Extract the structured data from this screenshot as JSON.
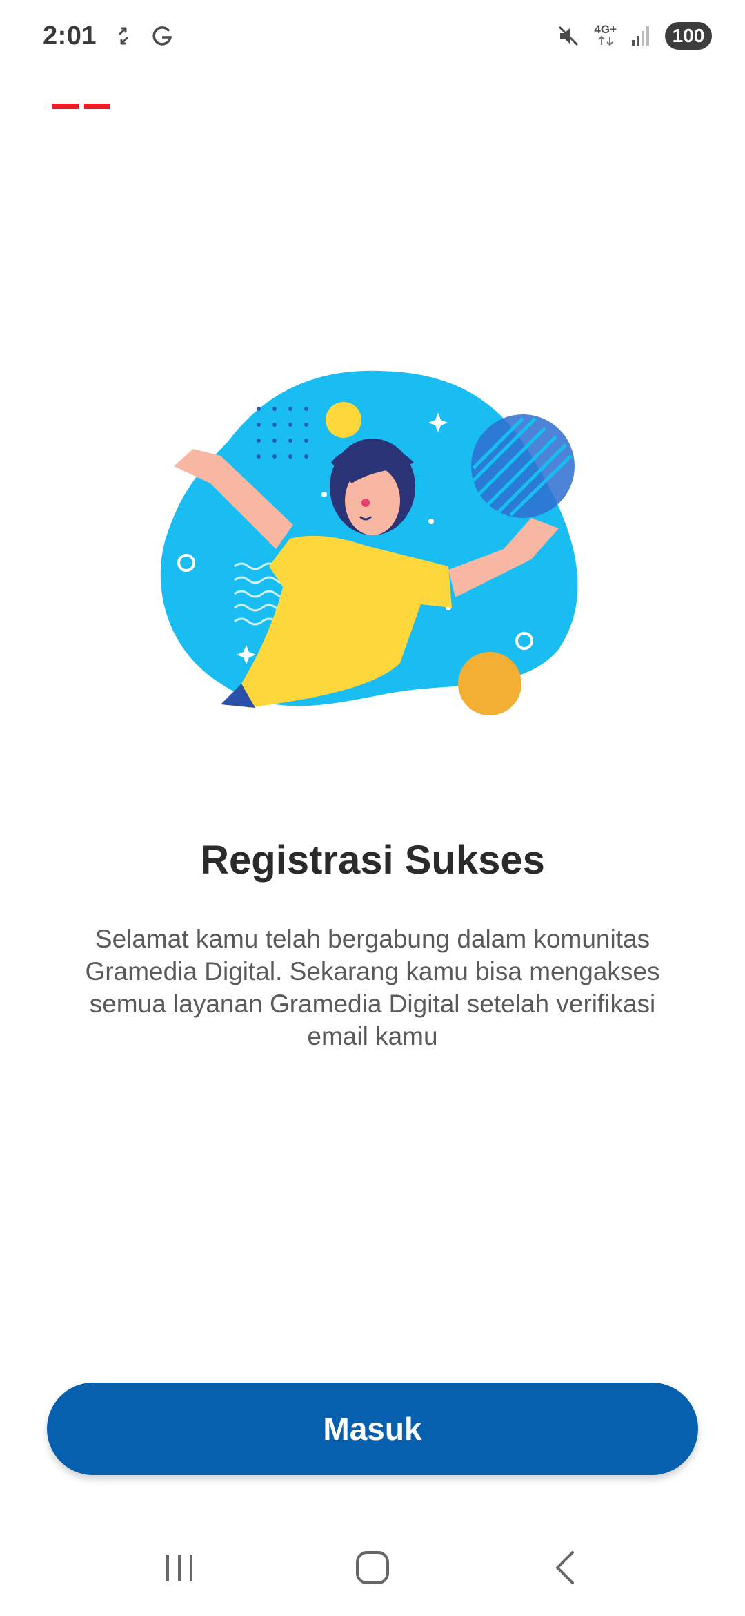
{
  "status_bar": {
    "time": "2:01",
    "network_type": "4G+",
    "battery": "100",
    "icons": [
      "sync-icon",
      "google-icon",
      "mute-icon",
      "signal-icon"
    ]
  },
  "brand": {
    "mark_color": "#ee1c25"
  },
  "content": {
    "title": "Registrasi Sukses",
    "message": "Selamat kamu telah bergabung dalam komunitas Gramedia Digital. Sekarang kamu bisa mengakses semua layanan Gramedia Digital setelah verifikasi email kamu"
  },
  "actions": {
    "login_label": "Masuk",
    "button_color": "#0760ae"
  },
  "nav": {
    "icons": [
      "recent-apps-icon",
      "home-icon",
      "back-icon"
    ]
  }
}
